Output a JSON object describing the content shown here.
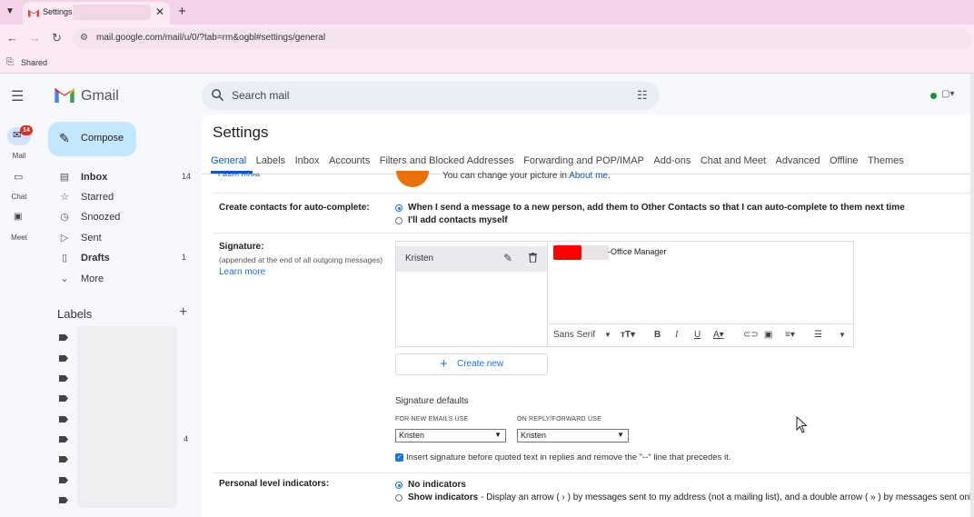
{
  "browser": {
    "tab_title": "Settings -",
    "url": "mail.google.com/mail/u/0/?tab=rm&ogbl#settings/general",
    "bookmark_label": "Shared"
  },
  "header": {
    "app_name": "Gmail",
    "search_placeholder": "Search mail"
  },
  "rail": {
    "mail_label": "Mail",
    "mail_badge": "14",
    "chat_label": "Chat",
    "meet_label": "Meet"
  },
  "sidebar": {
    "compose_label": "Compose",
    "items": [
      {
        "label": "Inbox",
        "count": "14",
        "icon": "inbox-icon"
      },
      {
        "label": "Starred",
        "count": "",
        "icon": "star-icon"
      },
      {
        "label": "Snoozed",
        "count": "",
        "icon": "clock-icon"
      },
      {
        "label": "Sent",
        "count": "",
        "icon": "send-icon"
      },
      {
        "label": "Drafts",
        "count": "1",
        "icon": "draft-icon"
      },
      {
        "label": "More",
        "count": "",
        "icon": "chevron-down-icon"
      }
    ],
    "labels_title": "Labels",
    "label_count": "4"
  },
  "settings": {
    "title": "Settings",
    "tabs": [
      "General",
      "Labels",
      "Inbox",
      "Accounts",
      "Filters and Blocked Addresses",
      "Forwarding and POP/IMAP",
      "Add-ons",
      "Chat and Meet",
      "Advanced",
      "Offline",
      "Themes"
    ],
    "cutoff_link": "Learn more",
    "about_prefix": "You can change your picture in ",
    "about_link": "About me",
    "about_suffix": ".",
    "contacts": {
      "label": "Create contacts for auto-complete:",
      "option_on": "When I send a message to a new person, add them to Other Contacts so that I can auto-complete to them next time",
      "option_off": "I'll add contacts myself"
    },
    "signature": {
      "label": "Signature:",
      "sub": "(appended at the end of all outgoing messages)",
      "learn_more": "Learn more",
      "name": "Kristen",
      "text": "-Office Manager",
      "font": "Sans Serif",
      "create_new": "Create new",
      "defaults_title": "Signature defaults",
      "new_emails_caption": "FOR NEW EMAILS USE",
      "new_emails_value": "Kristen",
      "reply_caption": "ON REPLY/FORWARD USE",
      "reply_value": "Kristen",
      "insert_before": "Insert signature before quoted text in replies and remove the \"--\" line that precedes it."
    },
    "indicators": {
      "label": "Personal level indicators:",
      "option_on": "No indicators",
      "option_off_bold": "Show indicators",
      "option_off_rest": " - Display an arrow ( › ) by messages sent to my address (not a mailing list), and a double arrow ( » ) by messages sent only"
    }
  },
  "colors": {
    "accent": "#0b57d0",
    "compose_bg": "#c2e7ff",
    "badge": "#d93025"
  }
}
